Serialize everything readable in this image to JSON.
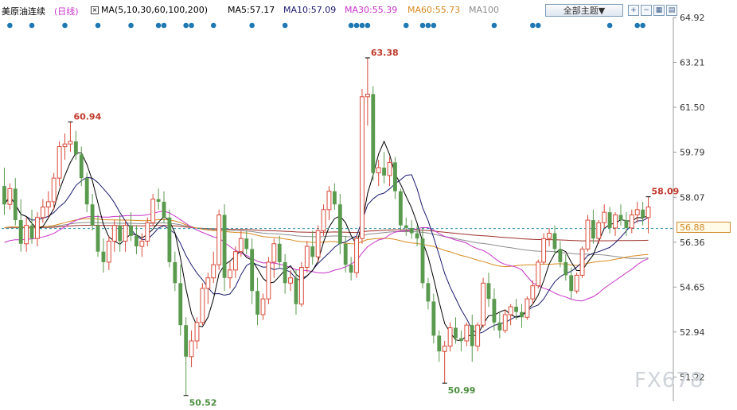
{
  "header": {
    "instrument": "美原油连续",
    "period": "(日线)",
    "ma_label": "MA(5,10,30,60,100,200)",
    "ma5": "MA5:57.17",
    "ma10": "MA10:57.09",
    "ma30": "MA30:55.39",
    "ma60": "MA60:55.73",
    "ma100": "MA100",
    "theme_button": "全部主题▼"
  },
  "colors": {
    "up": "#d94a38",
    "down": "#5a9a4e",
    "ma5": "#000000",
    "ma10": "#1a1a6e",
    "ma30": "#c832c8",
    "ma60": "#d98a1e",
    "ma100": "#8c8c8c",
    "ma200": "#a0302a",
    "dots": "#1f78b4"
  },
  "watermark": "FX678",
  "current_price_label": "56.88",
  "chart_data": {
    "type": "candlestick",
    "y_axis": {
      "min": 50.3,
      "max": 64.92,
      "ticks": [
        "64.92",
        "63.21",
        "61.50",
        "59.79",
        "58.07",
        "56.36",
        "54.65",
        "52.94",
        "51.22"
      ],
      "side": "right"
    },
    "current_price": 56.88,
    "annotations": [
      {
        "text": "60.94",
        "kind": "high",
        "index": 12
      },
      {
        "text": "63.38",
        "kind": "high",
        "index": 66
      },
      {
        "text": "50.52",
        "kind": "low",
        "index": 33
      },
      {
        "text": "50.99",
        "kind": "low",
        "index": 80
      },
      {
        "text": "58.09",
        "kind": "high",
        "index": 117
      }
    ],
    "event_dot_indices": [
      1,
      5,
      11,
      17,
      23,
      28,
      29,
      33,
      34,
      38,
      45,
      51,
      63,
      64,
      65,
      66,
      73,
      76,
      77,
      78,
      89,
      96,
      97,
      110,
      115,
      116
    ],
    "ohlc": [
      [
        58.5,
        59.2,
        57.4,
        57.8
      ],
      [
        57.8,
        58.6,
        57.6,
        58.4
      ],
      [
        58.4,
        58.8,
        57.0,
        57.2
      ],
      [
        57.2,
        58.0,
        56.0,
        56.3
      ],
      [
        56.3,
        57.3,
        56.0,
        57.0
      ],
      [
        57.0,
        57.6,
        56.3,
        56.5
      ],
      [
        56.5,
        57.5,
        56.2,
        57.3
      ],
      [
        57.3,
        58.0,
        57.1,
        57.7
      ],
      [
        57.7,
        58.3,
        57.3,
        57.9
      ],
      [
        57.9,
        59.0,
        57.6,
        58.8
      ],
      [
        58.8,
        60.2,
        58.5,
        60.0
      ],
      [
        60.0,
        60.5,
        59.5,
        60.1
      ],
      [
        60.1,
        60.94,
        59.8,
        60.2
      ],
      [
        60.2,
        60.6,
        59.5,
        59.7
      ],
      [
        59.7,
        60.0,
        58.5,
        58.8
      ],
      [
        58.8,
        59.0,
        57.5,
        57.8
      ],
      [
        57.8,
        58.2,
        56.8,
        57.0
      ],
      [
        57.0,
        57.4,
        55.8,
        56.0
      ],
      [
        56.0,
        56.5,
        55.2,
        55.6
      ],
      [
        55.6,
        56.6,
        55.3,
        56.4
      ],
      [
        56.4,
        57.2,
        56.0,
        57.0
      ],
      [
        57.0,
        57.4,
        56.0,
        56.4
      ],
      [
        56.4,
        57.2,
        56.0,
        57.0
      ],
      [
        57.0,
        57.5,
        56.4,
        56.6
      ],
      [
        56.6,
        57.0,
        55.9,
        56.2
      ],
      [
        56.2,
        56.7,
        55.8,
        56.4
      ],
      [
        56.4,
        57.3,
        56.2,
        57.1
      ],
      [
        57.1,
        58.2,
        57.0,
        58.0
      ],
      [
        58.0,
        58.4,
        57.6,
        57.9
      ],
      [
        57.9,
        58.3,
        57.1,
        57.3
      ],
      [
        57.3,
        57.6,
        55.4,
        55.6
      ],
      [
        55.6,
        56.0,
        54.5,
        54.8
      ],
      [
        54.8,
        55.5,
        52.8,
        53.2
      ],
      [
        53.2,
        53.5,
        50.52,
        52.0
      ],
      [
        52.0,
        53.0,
        51.6,
        52.6
      ],
      [
        52.6,
        53.5,
        52.3,
        53.3
      ],
      [
        53.3,
        54.8,
        53.2,
        54.6
      ],
      [
        54.6,
        55.2,
        54.0,
        55.0
      ],
      [
        55.0,
        56.0,
        54.8,
        55.5
      ],
      [
        55.5,
        57.6,
        55.3,
        57.4
      ],
      [
        57.4,
        57.8,
        54.5,
        55.0
      ],
      [
        55.0,
        55.6,
        54.6,
        55.3
      ],
      [
        55.3,
        56.2,
        55.0,
        56.0
      ],
      [
        56.0,
        56.8,
        55.8,
        56.5
      ],
      [
        56.5,
        56.8,
        55.9,
        56.1
      ],
      [
        56.1,
        56.5,
        54.0,
        54.5
      ],
      [
        54.5,
        55.0,
        53.2,
        53.6
      ],
      [
        53.6,
        54.4,
        53.4,
        54.2
      ],
      [
        54.2,
        55.8,
        54.0,
        55.6
      ],
      [
        55.6,
        56.5,
        55.0,
        56.3
      ],
      [
        56.3,
        56.6,
        55.4,
        55.6
      ],
      [
        55.6,
        55.9,
        54.4,
        54.8
      ],
      [
        54.8,
        55.3,
        54.5,
        55.0
      ],
      [
        55.0,
        55.3,
        53.6,
        54.0
      ],
      [
        54.0,
        55.6,
        53.9,
        55.4
      ],
      [
        55.4,
        56.4,
        55.2,
        56.2
      ],
      [
        56.2,
        56.8,
        55.5,
        55.8
      ],
      [
        55.8,
        57.0,
        55.6,
        56.8
      ],
      [
        56.8,
        57.8,
        56.6,
        57.6
      ],
      [
        57.6,
        58.5,
        57.2,
        58.3
      ],
      [
        58.3,
        58.6,
        57.6,
        57.8
      ],
      [
        57.8,
        58.2,
        55.9,
        56.3
      ],
      [
        56.3,
        56.6,
        55.2,
        55.5
      ],
      [
        55.5,
        55.8,
        54.9,
        55.2
      ],
      [
        55.2,
        56.6,
        55.0,
        56.5
      ],
      [
        56.5,
        62.2,
        56.3,
        61.9
      ],
      [
        61.9,
        63.38,
        60.8,
        62.0
      ],
      [
        62.0,
        62.3,
        58.7,
        59.0
      ],
      [
        59.0,
        59.5,
        58.5,
        59.2
      ],
      [
        59.2,
        59.8,
        58.6,
        58.9
      ],
      [
        58.9,
        59.6,
        58.5,
        59.4
      ],
      [
        59.4,
        59.6,
        58.0,
        58.3
      ],
      [
        58.3,
        58.4,
        56.8,
        57.0
      ],
      [
        57.0,
        57.3,
        56.6,
        56.9
      ],
      [
        56.9,
        57.2,
        56.5,
        56.7
      ],
      [
        56.7,
        57.0,
        56.2,
        56.5
      ],
      [
        56.5,
        56.9,
        54.6,
        54.8
      ],
      [
        54.8,
        55.0,
        53.8,
        54.1
      ],
      [
        54.1,
        54.4,
        52.5,
        52.8
      ],
      [
        52.8,
        53.0,
        51.8,
        52.2
      ],
      [
        52.2,
        52.6,
        50.99,
        52.4
      ],
      [
        52.4,
        53.3,
        52.2,
        53.1
      ],
      [
        53.1,
        53.5,
        52.5,
        52.7
      ],
      [
        52.7,
        53.0,
        52.2,
        52.6
      ],
      [
        52.6,
        53.3,
        52.4,
        53.2
      ],
      [
        53.2,
        53.6,
        51.8,
        52.4
      ],
      [
        52.4,
        53.3,
        52.2,
        53.2
      ],
      [
        53.2,
        55.0,
        53.1,
        54.8
      ],
      [
        54.8,
        55.2,
        53.9,
        54.2
      ],
      [
        54.2,
        54.6,
        53.0,
        53.3
      ],
      [
        53.3,
        53.7,
        52.7,
        53.0
      ],
      [
        53.0,
        53.8,
        52.9,
        53.6
      ],
      [
        53.6,
        54.0,
        53.2,
        53.9
      ],
      [
        53.9,
        54.2,
        53.4,
        53.7
      ],
      [
        53.7,
        54.0,
        53.1,
        53.5
      ],
      [
        53.5,
        54.3,
        53.4,
        54.2
      ],
      [
        54.2,
        54.9,
        54.0,
        54.7
      ],
      [
        54.7,
        55.7,
        54.6,
        55.6
      ],
      [
        55.6,
        56.7,
        55.5,
        56.5
      ],
      [
        56.5,
        56.9,
        56.2,
        56.7
      ],
      [
        56.7,
        57.0,
        55.9,
        56.1
      ],
      [
        56.1,
        56.4,
        55.4,
        55.6
      ],
      [
        55.6,
        55.9,
        54.9,
        55.1
      ],
      [
        55.1,
        55.4,
        54.2,
        54.5
      ],
      [
        54.5,
        55.2,
        54.4,
        55.1
      ],
      [
        55.1,
        56.2,
        55.0,
        56.1
      ],
      [
        56.1,
        57.4,
        56.0,
        57.2
      ],
      [
        57.2,
        57.6,
        56.3,
        56.5
      ],
      [
        56.5,
        57.2,
        56.3,
        57.1
      ],
      [
        57.1,
        57.8,
        56.9,
        57.5
      ],
      [
        57.5,
        57.7,
        56.7,
        56.9
      ],
      [
        56.9,
        57.5,
        56.6,
        57.4
      ],
      [
        57.4,
        57.8,
        57.0,
        57.2
      ],
      [
        57.2,
        57.5,
        56.6,
        56.9
      ],
      [
        56.9,
        57.6,
        56.7,
        57.4
      ],
      [
        57.4,
        57.9,
        57.1,
        57.6
      ],
      [
        57.6,
        57.9,
        57.0,
        57.3
      ],
      [
        57.3,
        58.09,
        56.7,
        57.7
      ]
    ]
  }
}
